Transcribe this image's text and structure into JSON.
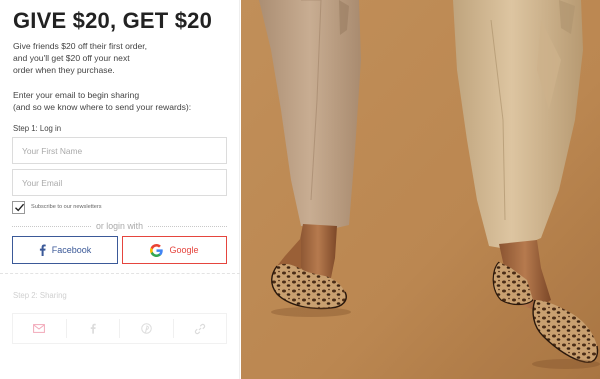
{
  "header": {
    "title": "GIVE $20, GET $20"
  },
  "intro": {
    "lines": [
      "Give friends $20 off their first order,",
      "and you'll get $20 off your next",
      "order when they purchase."
    ]
  },
  "prompt": {
    "lines": [
      "Enter your email to begin sharing",
      "(and so we know where to send your rewards):"
    ]
  },
  "step1": {
    "label": "Step 1: Log in"
  },
  "form": {
    "first_name_placeholder": "Your First Name",
    "first_name_value": "",
    "email_placeholder": "Your Email",
    "email_value": "",
    "newsletter_label": "Subscribe to our newsletters",
    "newsletter_checked": true
  },
  "divider": {
    "text": "or login with"
  },
  "social": {
    "facebook_label": "Facebook",
    "google_label": "Google"
  },
  "step2": {
    "label": "Step 2: Sharing"
  },
  "share_icons": [
    "email-icon",
    "facebook-icon",
    "pinterest-icon",
    "link-icon"
  ],
  "colors": {
    "facebook": "#3b5998",
    "google_border": "#e5453e",
    "photo_background": "#c9955d",
    "share_email_icon": "#f2a9b9"
  }
}
